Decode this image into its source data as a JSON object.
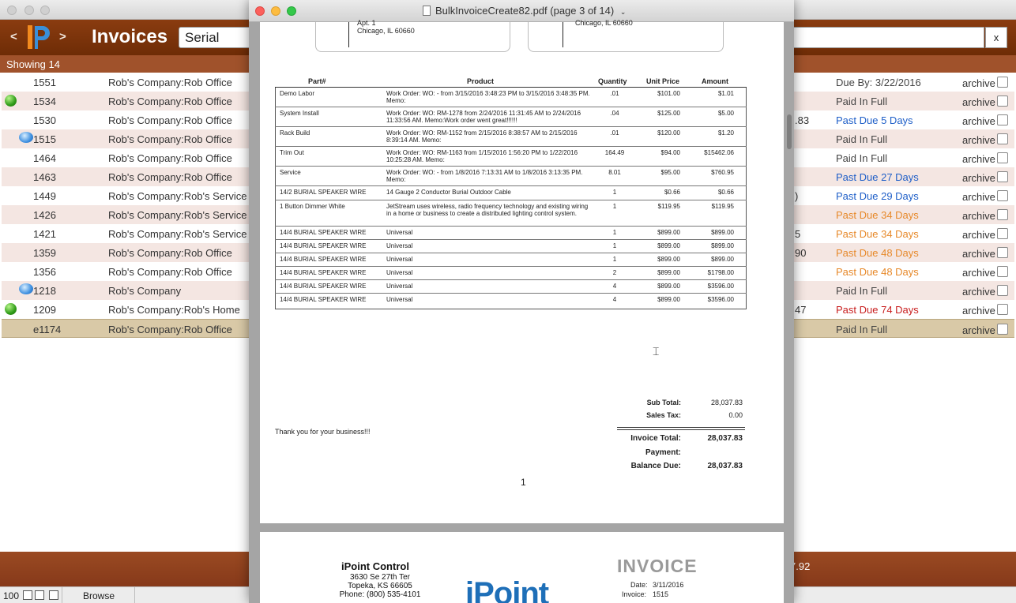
{
  "app": {
    "title": "Invoices",
    "search_value": "Serial",
    "clear_label": "x",
    "nav_back": "<",
    "nav_forward": ">",
    "showing": "Showing 14",
    "footer_value": "7.92",
    "status": {
      "zoom": "100",
      "mode": "Browse"
    },
    "colors": {
      "toolbar": "#7a3208",
      "accent": "#a0522b",
      "selected_row": "#d9c9a7"
    }
  },
  "invoices": [
    {
      "num": "1551",
      "company": "Rob's Company:Rob Office",
      "frag": "",
      "status": "Due By: 3/22/2016",
      "status_color": "gray",
      "icon": "",
      "archive": "archive"
    },
    {
      "num": "1534",
      "company": "Rob's Company:Rob Office",
      "frag": "",
      "status": "Paid In Full",
      "status_color": "gray",
      "icon": "green-dot",
      "archive": "archive"
    },
    {
      "num": "1530",
      "company": "Rob's Company:Rob Office",
      "frag": ".83",
      "status": "Past Due 5 Days",
      "status_color": "blue",
      "icon": "",
      "archive": "archive"
    },
    {
      "num": "1515",
      "company": "Rob's Company:Rob Office",
      "frag": "",
      "status": "Paid In Full",
      "status_color": "gray",
      "icon": "chat-bubble",
      "archive": "archive"
    },
    {
      "num": "1464",
      "company": "Rob's Company:Rob Office",
      "frag": "",
      "status": "Paid In Full",
      "status_color": "gray",
      "icon": "",
      "archive": "archive"
    },
    {
      "num": "1463",
      "company": "Rob's Company:Rob Office",
      "frag": "",
      "status": "Past Due 27 Days",
      "status_color": "blue",
      "icon": "",
      "archive": "archive"
    },
    {
      "num": "1449",
      "company": "Rob's Company:Rob's Service",
      "frag": ")",
      "status": "Past Due 29 Days",
      "status_color": "blue",
      "icon": "",
      "archive": "archive"
    },
    {
      "num": "1426",
      "company": "Rob's Company:Rob's Service",
      "frag": "",
      "status": "Past Due 34 Days",
      "status_color": "orange",
      "icon": "",
      "archive": "archive"
    },
    {
      "num": "1421",
      "company": "Rob's Company:Rob's Service",
      "frag": "5",
      "status": "Past Due 34 Days",
      "status_color": "orange",
      "icon": "",
      "archive": "archive"
    },
    {
      "num": "1359",
      "company": "Rob's Company:Rob Office",
      "frag": "90",
      "status": "Past Due 48 Days",
      "status_color": "orange",
      "icon": "",
      "archive": "archive"
    },
    {
      "num": "1356",
      "company": "Rob's Company:Rob Office",
      "frag": "",
      "status": "Past Due 48 Days",
      "status_color": "orange",
      "icon": "",
      "archive": "archive"
    },
    {
      "num": "1218",
      "company": "Rob's Company",
      "frag": "",
      "status": "Paid In Full",
      "status_color": "gray",
      "icon": "chat-bubble",
      "archive": "archive"
    },
    {
      "num": "1209",
      "company": "Rob's Company:Rob's Home",
      "frag": "47",
      "status": "Past Due 74 Days",
      "status_color": "red",
      "icon": "green-dot",
      "archive": "archive"
    },
    {
      "num": "e1174",
      "company": "Rob's Company:Rob Office",
      "frag": "",
      "status": "Paid In Full",
      "status_color": "gray",
      "icon": "",
      "archive": "archive",
      "selected": true
    }
  ],
  "pdf": {
    "title": "BulkInvoiceCreate82.pdf (page 3 of 14)",
    "address_left": [
      "Apt. 1",
      "Chicago, IL 60660"
    ],
    "address_right": [
      "Chicago, IL 60660"
    ],
    "columns": [
      "Part#",
      "Product",
      "Quantity",
      "Unit Price",
      "Amount"
    ],
    "rows": [
      {
        "part": "Demo Labor",
        "product": "Work Order: WO: - from 3/15/2016 3:48:23 PM to 3/15/2016 3:48:35 PM. Memo:",
        "qty": ".01",
        "unit": "$101.00",
        "amount": "$1.01"
      },
      {
        "part": "System Install",
        "product": "Work Order: WO: RM-1278 from 2/24/2016 11:31:45 AM to 2/24/2016 11:33:56 AM. Memo:Work order went great!!!!!!",
        "qty": ".04",
        "unit": "$125.00",
        "amount": "$5.00"
      },
      {
        "part": "Rack Build",
        "product": "Work Order: WO: RM-1152 from 2/15/2016 8:38:57 AM to 2/15/2016 8:39:14 AM. Memo:",
        "qty": ".01",
        "unit": "$120.00",
        "amount": "$1.20"
      },
      {
        "part": "Trim Out",
        "product": "Work Order: WO: RM-1163 from 1/15/2016 1:56:20 PM to 1/22/2016 10:25:28 AM. Memo:",
        "qty": "164.49",
        "unit": "$94.00",
        "amount": "$15462.06"
      },
      {
        "part": "Service",
        "product": "Work Order: WO: - from 1/8/2016 7:13:31 AM to 1/8/2016 3:13:35 PM. Memo:",
        "qty": "8.01",
        "unit": "$95.00",
        "amount": "$760.95"
      },
      {
        "part": "14/2 BURIAL SPEAKER WIRE",
        "product": "14 Gauge 2 Conductor Burial Outdoor Cable",
        "qty": "1",
        "unit": "$0.66",
        "amount": "$0.66"
      },
      {
        "part": "1 Button Dimmer White",
        "product": "JetStream uses wireless, radio frequency technology and existing wiring in a home or business to create a distributed lighting control system.",
        "qty": "1",
        "unit": "$119.95",
        "amount": "$119.95"
      },
      {
        "part": "14/4 BURIAL SPEAKER WIRE",
        "product": "Universal",
        "qty": "1",
        "unit": "$899.00",
        "amount": "$899.00"
      },
      {
        "part": "14/4 BURIAL SPEAKER WIRE",
        "product": "Universal",
        "qty": "1",
        "unit": "$899.00",
        "amount": "$899.00"
      },
      {
        "part": "14/4 BURIAL SPEAKER WIRE",
        "product": "Universal",
        "qty": "1",
        "unit": "$899.00",
        "amount": "$899.00"
      },
      {
        "part": "14/4 BURIAL SPEAKER WIRE",
        "product": "Universal",
        "qty": "2",
        "unit": "$899.00",
        "amount": "$1798.00"
      },
      {
        "part": "14/4 BURIAL SPEAKER WIRE",
        "product": "Universal",
        "qty": "4",
        "unit": "$899.00",
        "amount": "$3596.00"
      },
      {
        "part": "14/4 BURIAL SPEAKER WIRE",
        "product": "Universal",
        "qty": "4",
        "unit": "$899.00",
        "amount": "$3596.00"
      }
    ],
    "totals": {
      "subtotal_label": "Sub Total:",
      "subtotal": "28,037.83",
      "tax_label": "Sales Tax:",
      "tax": "0.00",
      "invoice_total_label": "Invoice Total:",
      "invoice_total": "28,037.83",
      "payment_label": "Payment:",
      "payment": "",
      "balance_label": "Balance Due:",
      "balance": "28,037.83"
    },
    "thanks": "Thank you for your business!!!",
    "page_number": "1",
    "next_page": {
      "company": "iPoint Control",
      "address": [
        "3630 Se 27th Ter",
        "Topeka, KS 66605",
        "Phone: (800) 535-4101"
      ],
      "invoice_word": "INVOICE",
      "date_label": "Date:",
      "date": "3/11/2016",
      "invoice_label": "Invoice:",
      "invoice": "1515",
      "logo_text": "iPoint"
    }
  }
}
